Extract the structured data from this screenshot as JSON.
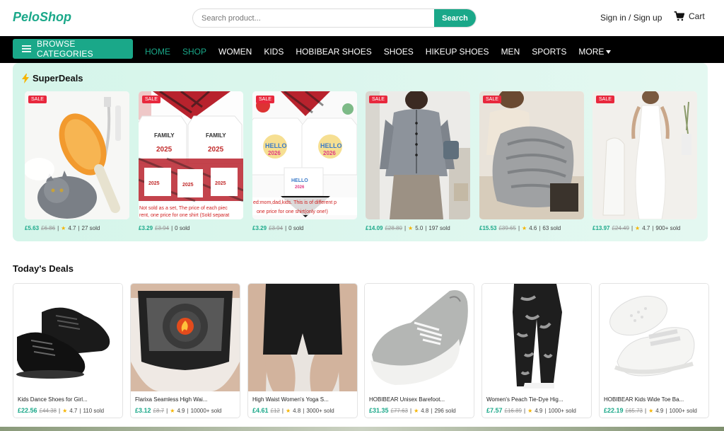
{
  "header": {
    "logo": "PeloShop",
    "search_placeholder": "Search product...",
    "search_button": "Search",
    "signin": "Sign in / Sign up",
    "cart": "Cart"
  },
  "nav": {
    "browse": "BROWSE CATEGORIES",
    "items": [
      "HOME",
      "SHOP",
      "WOMEN",
      "KIDS",
      "HOBIBEAR SHOES",
      "SHOES",
      "HIKEUP SHOES",
      "MEN",
      "SPORTS",
      "MORE"
    ]
  },
  "superdeals": {
    "title": "SuperDeals",
    "badge": "SALE",
    "items": [
      {
        "price": "£5.63",
        "old": "£6.86",
        "rating": "4.7",
        "sold": "27 sold",
        "overlay": ""
      },
      {
        "price": "£3.29",
        "old": "£3.94",
        "rating": "",
        "sold": "0 sold",
        "overlay": "Not sold as a set, The price of each piec\nrent, one price for one shirt (Sold separat"
      },
      {
        "price": "£3.29",
        "old": "£3.94",
        "rating": "",
        "sold": "0 sold",
        "overlay": "ed:mom,dad,kids. This is of different p\none price for one shirt(only one!)"
      },
      {
        "price": "£14.09",
        "old": "£28.80",
        "rating": "5.0",
        "sold": "197 sold",
        "overlay": ""
      },
      {
        "price": "£15.53",
        "old": "£39.65",
        "rating": "4.6",
        "sold": "63 sold",
        "overlay": ""
      },
      {
        "price": "£13.97",
        "old": "£24.49",
        "rating": "4.7",
        "sold": "900+ sold",
        "overlay": ""
      }
    ]
  },
  "todays_deals": {
    "title": "Today's Deals",
    "items": [
      {
        "name": "Kids Dance Shoes for Girl...",
        "price": "£22.56",
        "old": "£44.38",
        "rating": "4.7",
        "sold": "110 sold"
      },
      {
        "name": "Flarixa Seamless High Wai...",
        "price": "£3.12",
        "old": "£8.7",
        "rating": "4.9",
        "sold": "10000+ sold"
      },
      {
        "name": "High Waist Women's Yoga S...",
        "price": "£4.61",
        "old": "£12",
        "rating": "4.8",
        "sold": "3000+ sold"
      },
      {
        "name": "HOBIBEAR Unisex Barefoot...",
        "price": "£31.35",
        "old": "£77.63",
        "rating": "4.8",
        "sold": "296 sold"
      },
      {
        "name": "Women's Peach Tie-Dye Hig...",
        "price": "£7.57",
        "old": "£16.89",
        "rating": "4.9",
        "sold": "1000+ sold"
      },
      {
        "name": "HOBIBEAR Kids Wide Toe Ba...",
        "price": "£22.19",
        "old": "£65.73",
        "rating": "4.9",
        "sold": "1000+ sold"
      }
    ]
  },
  "colors": {
    "accent": "#1aa889",
    "sale": "#e8283d",
    "nav_bg": "#000000"
  }
}
